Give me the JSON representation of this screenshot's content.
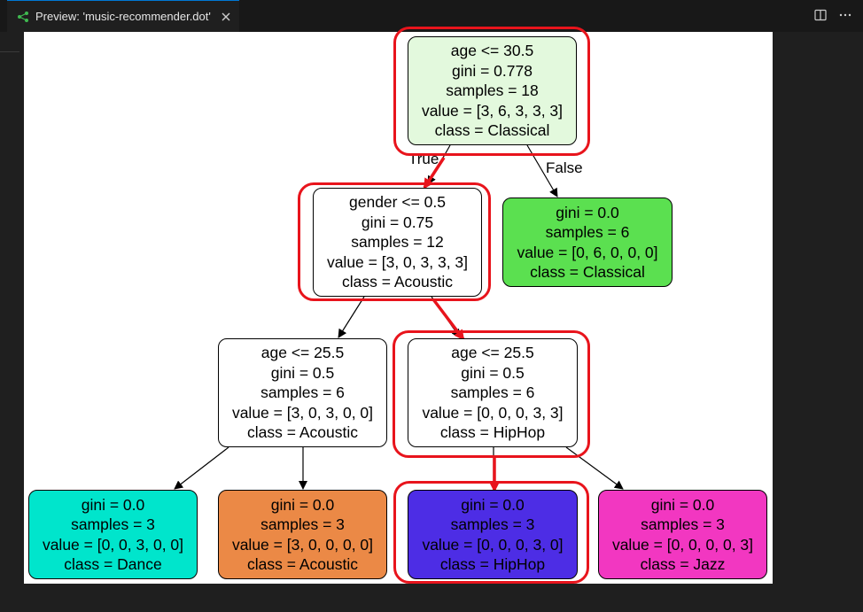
{
  "tab": {
    "title": "Preview: 'music-recommender.dot'",
    "icon": "graph-preview-icon",
    "close_icon": "close-icon"
  },
  "toolbar": {
    "split_icon": "split-editor-icon",
    "more_icon": "more-actions-icon"
  },
  "colors": {
    "highlight": "#e8141c",
    "root": "#e3f9dd",
    "classical_leaf": "#5be050",
    "dance_leaf": "#00e5cc",
    "acoustic_leaf": "#eb8946",
    "hiphop_leaf": "#4d2de5",
    "jazz_leaf": "#f237c1",
    "internal": "#ffffff"
  },
  "edge_labels": {
    "true": "True",
    "false": "False"
  },
  "nodes": {
    "root": {
      "lines": [
        "age <= 30.5",
        "gini = 0.778",
        "samples = 18",
        "value = [3, 6, 3, 3, 3]",
        "class = Classical"
      ]
    },
    "gender_split": {
      "lines": [
        "gender <= 0.5",
        "gini = 0.75",
        "samples = 12",
        "value = [3, 0, 3, 3, 3]",
        "class = Acoustic"
      ]
    },
    "classical_leaf": {
      "lines": [
        "gini = 0.0",
        "samples = 6",
        "value = [0, 6, 0, 0, 0]",
        "class = Classical"
      ]
    },
    "age_split_left": {
      "lines": [
        "age <= 25.5",
        "gini = 0.5",
        "samples = 6",
        "value = [3, 0, 3, 0, 0]",
        "class = Acoustic"
      ]
    },
    "age_split_right": {
      "lines": [
        "age <= 25.5",
        "gini = 0.5",
        "samples = 6",
        "value = [0, 0, 0, 3, 3]",
        "class = HipHop"
      ]
    },
    "dance_leaf": {
      "lines": [
        "gini = 0.0",
        "samples = 3",
        "value = [0, 0, 3, 0, 0]",
        "class = Dance"
      ]
    },
    "acoustic_leaf": {
      "lines": [
        "gini = 0.0",
        "samples = 3",
        "value = [3, 0, 0, 0, 0]",
        "class = Acoustic"
      ]
    },
    "hiphop_leaf": {
      "lines": [
        "gini = 0.0",
        "samples = 3",
        "value = [0, 0, 0, 3, 0]",
        "class = HipHop"
      ]
    },
    "jazz_leaf": {
      "lines": [
        "gini = 0.0",
        "samples = 3",
        "value = [0, 0, 0, 0, 3]",
        "class = Jazz"
      ]
    }
  }
}
